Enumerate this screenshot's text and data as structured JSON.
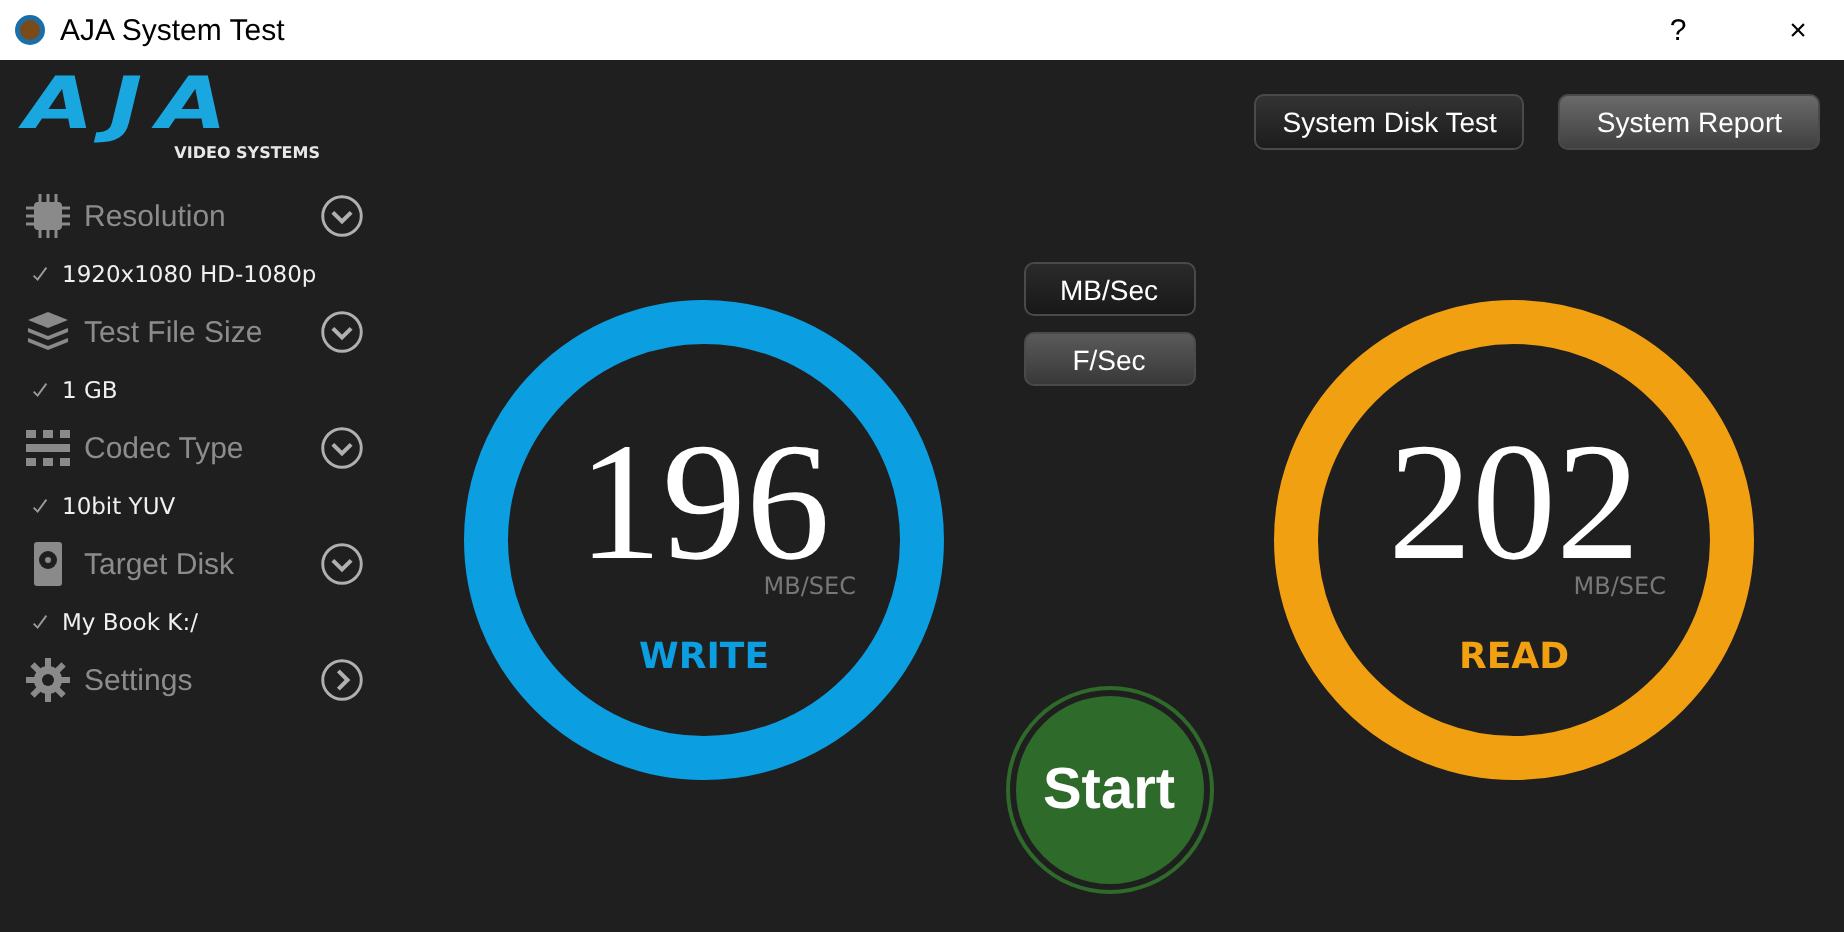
{
  "window": {
    "title": "AJA System Test",
    "help": "?",
    "close": "×"
  },
  "logo": {
    "mark": "AJA",
    "tagline": "VIDEO SYSTEMS"
  },
  "sidebar": {
    "items": [
      {
        "label": "Resolution",
        "kind": "dropdown",
        "value": "1920x1080 HD-1080p"
      },
      {
        "label": "Test File Size",
        "kind": "dropdown",
        "value": "1 GB"
      },
      {
        "label": "Codec Type",
        "kind": "dropdown",
        "value": "10bit YUV"
      },
      {
        "label": "Target Disk",
        "kind": "dropdown",
        "value": "My Book K:/"
      },
      {
        "label": "Settings",
        "kind": "link"
      }
    ]
  },
  "top_buttons": [
    "System Disk Test",
    "System Report"
  ],
  "units": [
    {
      "label": "MB/Sec",
      "selected": true
    },
    {
      "label": "F/Sec",
      "selected": false
    }
  ],
  "gauges": [
    {
      "label": "WRITE",
      "value": "196",
      "unit": "MB/SEC",
      "color": "#0b9ee0"
    },
    {
      "label": "READ",
      "value": "202",
      "unit": "MB/SEC",
      "color": "#f0a010"
    }
  ],
  "start_button": "Start"
}
